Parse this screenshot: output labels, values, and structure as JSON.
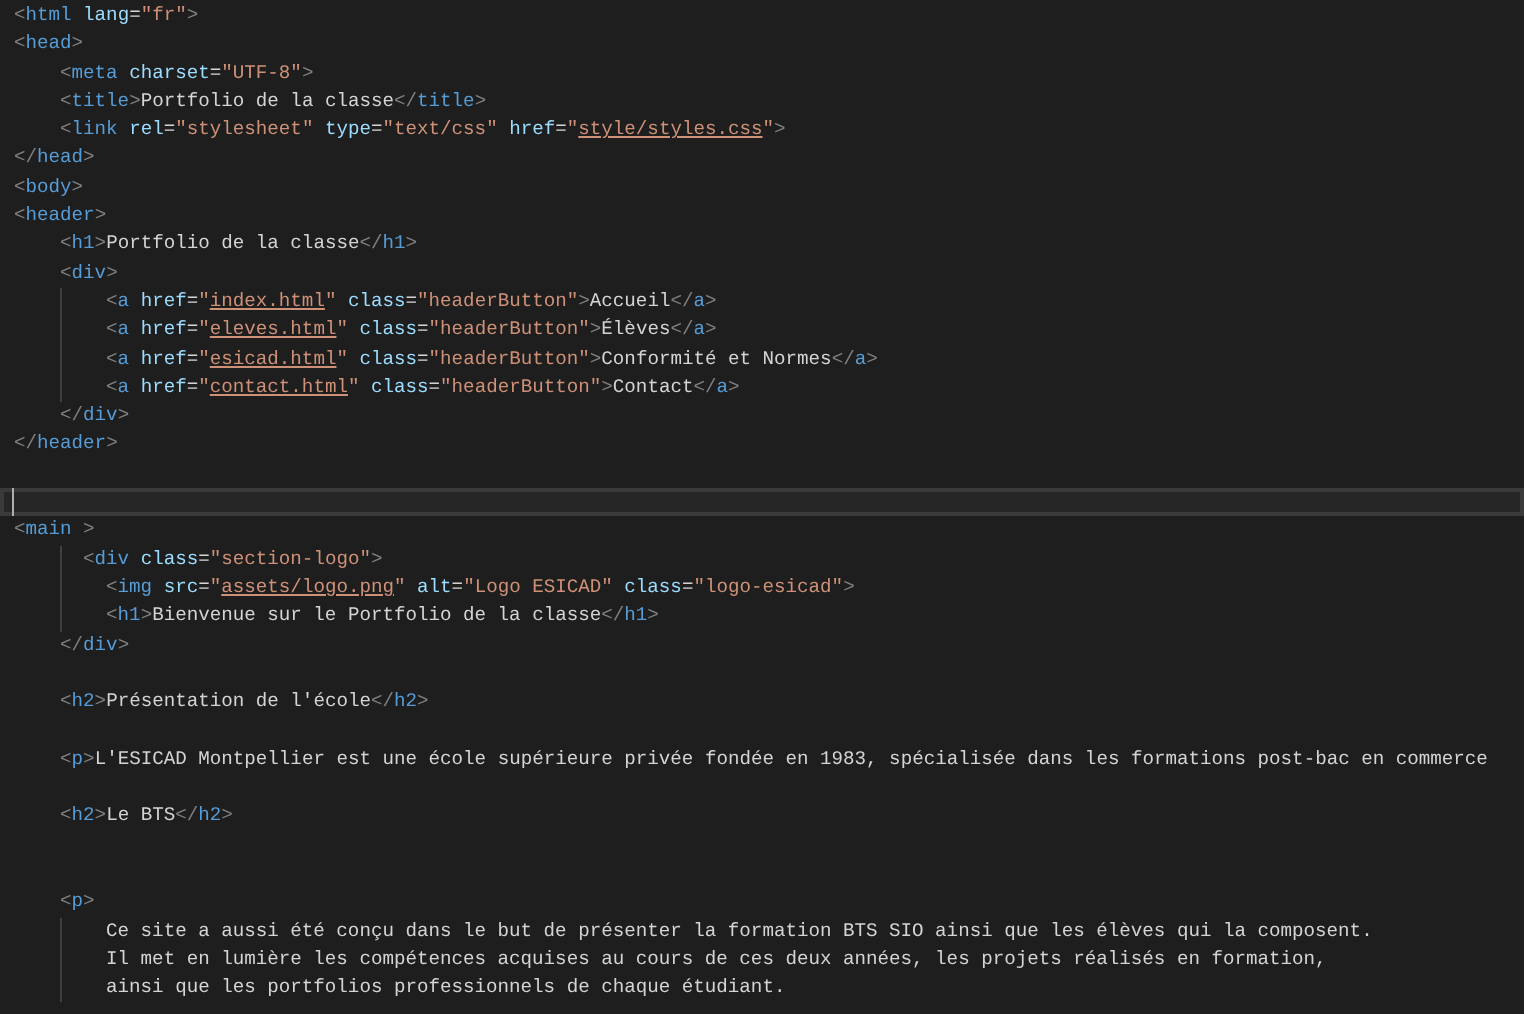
{
  "editor": {
    "lines": [
      {
        "selected": false,
        "kind": "top",
        "tokens": [
          {
            "kind": "p",
            "text": "<"
          },
          {
            "kind": "t",
            "text": "html"
          },
          {
            "kind": "a",
            "text": "lang"
          },
          {
            "kind": "x",
            "text": "="
          },
          {
            "kind": "s",
            "text": "\"fr\""
          },
          {
            "kind": "p",
            "text": ">"
          }
        ]
      },
      {
        "selected": false,
        "kind": "top",
        "tokens": [
          {
            "kind": "p",
            "text": "<"
          },
          {
            "kind": "t",
            "text": "head"
          },
          {
            "kind": "p",
            "text": ">"
          }
        ]
      },
      {
        "selected": false,
        "kind": "inner",
        "tokens": [
          {
            "kind": "p",
            "text": "<"
          },
          {
            "kind": "t",
            "text": "meta"
          },
          {
            "kind": "a",
            "text": "charset"
          },
          {
            "kind": "x",
            "text": "="
          },
          {
            "kind": "s",
            "text": "\"UTF-8\""
          },
          {
            "kind": "p",
            "text": ">"
          }
        ]
      },
      {
        "selected": false,
        "kind": "inner",
        "tokens": [
          {
            "kind": "p",
            "text": "<"
          },
          {
            "kind": "t",
            "text": "title"
          },
          {
            "kind": "p",
            "text": ">"
          },
          {
            "kind": "x",
            "text": "Portfolio de la classe"
          },
          {
            "kind": "p",
            "text": "</"
          },
          {
            "kind": "t",
            "text": "title"
          },
          {
            "kind": "p",
            "text": ">"
          }
        ]
      },
      {
        "selected": false,
        "kind": "inner",
        "tokens": [
          {
            "kind": "p",
            "text": "<"
          },
          {
            "kind": "t",
            "text": "link"
          },
          {
            "kind": "a",
            "text": "rel"
          },
          {
            "kind": "x",
            "text": "="
          },
          {
            "kind": "s",
            "text": "\"stylesheet\""
          },
          {
            "kind": "a",
            "text": "type"
          },
          {
            "kind": "x",
            "text": "="
          },
          {
            "kind": "s",
            "text": "\"text/css\""
          },
          {
            "kind": "a",
            "text": "href"
          },
          {
            "kind": "x",
            "text": "="
          },
          {
            "kind": "s",
            "text": "\""
          },
          {
            "kind": "l",
            "text": "style/styles.css"
          },
          {
            "kind": "s",
            "text": "\""
          },
          {
            "kind": "p",
            "text": ">"
          }
        ]
      },
      {
        "selected": false,
        "kind": "top",
        "tokens": [
          {
            "kind": "p",
            "text": "</"
          },
          {
            "kind": "t",
            "text": "head"
          },
          {
            "kind": "p",
            "text": ">"
          }
        ]
      },
      {
        "selected": false,
        "kind": "top",
        "tokens": [
          {
            "kind": "p",
            "text": "<"
          },
          {
            "kind": "t",
            "text": "body"
          },
          {
            "kind": "p",
            "text": ">"
          }
        ]
      },
      {
        "selected": false,
        "kind": "top",
        "tokens": [
          {
            "kind": "p",
            "text": "<"
          },
          {
            "kind": "t",
            "text": "header"
          },
          {
            "kind": "p",
            "text": ">"
          }
        ]
      },
      {
        "selected": false,
        "kind": "inner",
        "tokens": [
          {
            "kind": "p",
            "text": "<"
          },
          {
            "kind": "t",
            "text": "h1"
          },
          {
            "kind": "p",
            "text": ">"
          },
          {
            "kind": "x",
            "text": "Portfolio de la classe"
          },
          {
            "kind": "p",
            "text": "</"
          },
          {
            "kind": "t",
            "text": "h1"
          },
          {
            "kind": "p",
            "text": ">"
          }
        ]
      },
      {
        "selected": false,
        "kind": "inner",
        "tokens": [
          {
            "kind": "p",
            "text": "<"
          },
          {
            "kind": "t",
            "text": "div"
          },
          {
            "kind": "p",
            "text": ">"
          }
        ]
      },
      {
        "selected": false,
        "kind": "deep",
        "tokens": [
          {
            "kind": "p",
            "text": "<"
          },
          {
            "kind": "t",
            "text": "a"
          },
          {
            "kind": "a",
            "text": "href"
          },
          {
            "kind": "x",
            "text": "="
          },
          {
            "kind": "s",
            "text": "\""
          },
          {
            "kind": "l",
            "text": "index.html"
          },
          {
            "kind": "s",
            "text": "\""
          },
          {
            "kind": "a",
            "text": "class"
          },
          {
            "kind": "x",
            "text": "="
          },
          {
            "kind": "s",
            "text": "\"headerButton\""
          },
          {
            "kind": "p",
            "text": ">"
          },
          {
            "kind": "x",
            "text": "Accueil"
          },
          {
            "kind": "p",
            "text": "</"
          },
          {
            "kind": "t",
            "text": "a"
          },
          {
            "kind": "p",
            "text": ">"
          }
        ]
      },
      {
        "selected": false,
        "kind": "deep",
        "tokens": [
          {
            "kind": "p",
            "text": "<"
          },
          {
            "kind": "t",
            "text": "a"
          },
          {
            "kind": "a",
            "text": "href"
          },
          {
            "kind": "x",
            "text": "="
          },
          {
            "kind": "s",
            "text": "\""
          },
          {
            "kind": "l",
            "text": "eleves.html"
          },
          {
            "kind": "s",
            "text": "\""
          },
          {
            "kind": "a",
            "text": "class"
          },
          {
            "kind": "x",
            "text": "="
          },
          {
            "kind": "s",
            "text": "\"headerButton\""
          },
          {
            "kind": "p",
            "text": ">"
          },
          {
            "kind": "x",
            "text": "Élèves"
          },
          {
            "kind": "p",
            "text": "</"
          },
          {
            "kind": "t",
            "text": "a"
          },
          {
            "kind": "p",
            "text": ">"
          }
        ]
      },
      {
        "selected": false,
        "kind": "deep",
        "tokens": [
          {
            "kind": "p",
            "text": "<"
          },
          {
            "kind": "t",
            "text": "a"
          },
          {
            "kind": "a",
            "text": "href"
          },
          {
            "kind": "x",
            "text": "="
          },
          {
            "kind": "s",
            "text": "\""
          },
          {
            "kind": "l",
            "text": "esicad.html"
          },
          {
            "kind": "s",
            "text": "\""
          },
          {
            "kind": "a",
            "text": "class"
          },
          {
            "kind": "x",
            "text": "="
          },
          {
            "kind": "s",
            "text": "\"headerButton\""
          },
          {
            "kind": "p",
            "text": ">"
          },
          {
            "kind": "x",
            "text": "Conformité et Normes"
          },
          {
            "kind": "p",
            "text": "</"
          },
          {
            "kind": "t",
            "text": "a"
          },
          {
            "kind": "p",
            "text": ">"
          }
        ]
      },
      {
        "selected": false,
        "kind": "deep",
        "tokens": [
          {
            "kind": "p",
            "text": "<"
          },
          {
            "kind": "t",
            "text": "a"
          },
          {
            "kind": "a",
            "text": "href"
          },
          {
            "kind": "x",
            "text": "="
          },
          {
            "kind": "s",
            "text": "\""
          },
          {
            "kind": "l",
            "text": "contact.html"
          },
          {
            "kind": "s",
            "text": "\""
          },
          {
            "kind": "a",
            "text": "class"
          },
          {
            "kind": "x",
            "text": "="
          },
          {
            "kind": "s",
            "text": "\"headerButton\""
          },
          {
            "kind": "p",
            "text": ">"
          },
          {
            "kind": "x",
            "text": "Contact"
          },
          {
            "kind": "p",
            "text": "</"
          },
          {
            "kind": "t",
            "text": "a"
          },
          {
            "kind": "p",
            "text": ">"
          }
        ]
      },
      {
        "selected": false,
        "kind": "inner",
        "tokens": [
          {
            "kind": "p",
            "text": "</"
          },
          {
            "kind": "t",
            "text": "div"
          },
          {
            "kind": "p",
            "text": ">"
          }
        ]
      },
      {
        "selected": false,
        "kind": "top",
        "tokens": [
          {
            "kind": "p",
            "text": "</"
          },
          {
            "kind": "t",
            "text": "header"
          },
          {
            "kind": "p",
            "text": ">"
          }
        ]
      },
      {
        "selected": false,
        "kind": "top"
      },
      {
        "selected": true,
        "kind": "top"
      },
      {
        "selected": false,
        "kind": "top",
        "tokens": [
          {
            "kind": "p",
            "text": "<"
          },
          {
            "kind": "t",
            "text": "main"
          },
          {
            "kind": "q",
            "text": ">"
          }
        ]
      },
      {
        "selected": false,
        "kind": "shifted",
        "tokens": [
          {
            "kind": "p",
            "text": "<"
          },
          {
            "kind": "t",
            "text": "div"
          },
          {
            "kind": "a",
            "text": "class"
          },
          {
            "kind": "x",
            "text": "="
          },
          {
            "kind": "s",
            "text": "\"section-logo\""
          },
          {
            "kind": "p",
            "text": ">"
          }
        ]
      },
      {
        "selected": false,
        "kind": "deep",
        "tokens": [
          {
            "kind": "p",
            "text": "<"
          },
          {
            "kind": "t",
            "text": "img"
          },
          {
            "kind": "a",
            "text": "src"
          },
          {
            "kind": "x",
            "text": "="
          },
          {
            "kind": "s",
            "text": "\""
          },
          {
            "kind": "l",
            "text": "assets/logo.png"
          },
          {
            "kind": "s",
            "text": "\""
          },
          {
            "kind": "a",
            "text": "alt"
          },
          {
            "kind": "x",
            "text": "="
          },
          {
            "kind": "s",
            "text": "\"Logo ESICAD\""
          },
          {
            "kind": "a",
            "text": "class"
          },
          {
            "kind": "x",
            "text": "="
          },
          {
            "kind": "s",
            "text": "\"logo-esicad\""
          },
          {
            "kind": "p",
            "text": ">"
          }
        ]
      },
      {
        "selected": false,
        "kind": "deep",
        "tokens": [
          {
            "kind": "p",
            "text": "<"
          },
          {
            "kind": "t",
            "text": "h1"
          },
          {
            "kind": "p",
            "text": ">"
          },
          {
            "kind": "x",
            "text": "Bienvenue sur le Portfolio de la classe"
          },
          {
            "kind": "p",
            "text": "</"
          },
          {
            "kind": "t",
            "text": "h1"
          },
          {
            "kind": "p",
            "text": ">"
          }
        ]
      },
      {
        "selected": false,
        "kind": "inner",
        "tokens": [
          {
            "kind": "p",
            "text": "</"
          },
          {
            "kind": "t",
            "text": "div"
          },
          {
            "kind": "p",
            "text": ">"
          }
        ]
      },
      {
        "selected": false,
        "kind": "top"
      },
      {
        "selected": false,
        "kind": "inner",
        "tokens": [
          {
            "kind": "p",
            "text": "<"
          },
          {
            "kind": "t",
            "text": "h2"
          },
          {
            "kind": "p",
            "text": ">"
          },
          {
            "kind": "x",
            "text": "Présentation de l'école"
          },
          {
            "kind": "p",
            "text": "</"
          },
          {
            "kind": "t",
            "text": "h2"
          },
          {
            "kind": "p",
            "text": ">"
          }
        ]
      },
      {
        "selected": false,
        "kind": "top"
      },
      {
        "selected": false,
        "kind": "inner",
        "tokens": [
          {
            "kind": "p",
            "text": "<"
          },
          {
            "kind": "t",
            "text": "p"
          },
          {
            "kind": "p",
            "text": ">"
          },
          {
            "kind": "x",
            "text": "L'ESICAD Montpellier est une école supérieure privée fondée en 1983, spécialisée dans les formations post-bac en commerce"
          }
        ]
      },
      {
        "selected": false,
        "kind": "top"
      },
      {
        "selected": false,
        "kind": "inner",
        "tokens": [
          {
            "kind": "p",
            "text": "<"
          },
          {
            "kind": "t",
            "text": "h2"
          },
          {
            "kind": "p",
            "text": ">"
          },
          {
            "kind": "x",
            "text": "Le BTS"
          },
          {
            "kind": "p",
            "text": "</"
          },
          {
            "kind": "t",
            "text": "h2"
          },
          {
            "kind": "p",
            "text": ">"
          }
        ]
      },
      {
        "selected": false,
        "kind": "top"
      },
      {
        "selected": false,
        "kind": "top"
      },
      {
        "selected": false,
        "kind": "inner",
        "tokens": [
          {
            "kind": "p",
            "text": "<"
          },
          {
            "kind": "t",
            "text": "p"
          },
          {
            "kind": "p",
            "text": ">"
          }
        ]
      },
      {
        "selected": false,
        "kind": "deep",
        "tokens": [
          {
            "kind": "x",
            "text": "Ce site a aussi été conçu dans le but de présenter la formation BTS SIO ainsi que les élèves qui la composent."
          }
        ]
      },
      {
        "selected": false,
        "kind": "deep",
        "tokens": [
          {
            "kind": "x",
            "text": "Il met en lumière les compétences acquises au cours de ces deux années, les projets réalisés en formation,"
          }
        ]
      },
      {
        "selected": false,
        "kind": "deep",
        "tokens": [
          {
            "kind": "x",
            "text": "ainsi que les portfolios professionnels de chaque étudiant."
          }
        ]
      }
    ]
  }
}
